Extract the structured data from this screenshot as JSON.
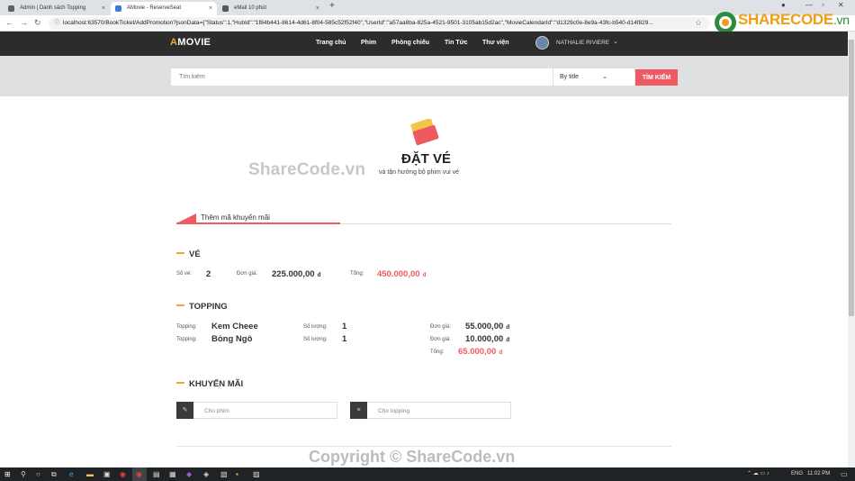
{
  "browser": {
    "tabs": [
      {
        "title": "Admin | Danh sách Topping",
        "close": "×",
        "fav_color": "#5f6368"
      },
      {
        "title": "AMovie - ReserveSeat",
        "close": "×",
        "fav_color": "#3d7ad6"
      },
      {
        "title": "eMail 10 phút",
        "close": "×",
        "fav_color": "#555555"
      }
    ],
    "new_tab": "+",
    "url": "localhost:63570/BookTicket/AddPromotion?jsonData={\"Status\":1,\"HubId\":\"1f84b441-8614-4d61-8f04-585c52f52f40\",\"UserId\":\"a57aa8ba-825a-4521-9501-3105ab15d2ac\",\"MovieCalendarId\":\"d1329c0e-8e9a-43fc-b540-d14f829..."
  },
  "header": {
    "logo_prefix": "A",
    "logo_rest": "MOVIE",
    "menu": [
      "Trang chủ",
      "Phim",
      "Phòng chiếu",
      "Tin Tức",
      "Thư viện"
    ],
    "user_name": "NATHALIE RIVIERE"
  },
  "search": {
    "placeholder": "Tìm kiếm",
    "select_value": "By title",
    "button": "TÌM KIẾM"
  },
  "page": {
    "title": "ĐẶT VÉ",
    "subtitle": "và tận hưởng bộ phim vui vẻ",
    "tab_label": "Thêm mã khuyến mãi"
  },
  "ticket": {
    "section": "VÉ",
    "qty_label": "Số vé:",
    "qty": "2",
    "price_label": "Đơn giá:",
    "price": "225.000,00",
    "total_label": "Tổng:",
    "total": "450.000,00",
    "currency": "đ"
  },
  "topping": {
    "section": "TOPPING",
    "item_label": "Topping:",
    "qty_label": "Số lượng:",
    "price_label": "Đơn giá:",
    "total_label": "Tổng:",
    "items": [
      {
        "name": "Kem Cheee",
        "qty": "1",
        "price": "55.000,00"
      },
      {
        "name": "Bỏng Ngô",
        "qty": "1",
        "price": "10.000,00"
      }
    ],
    "total": "65.000,00",
    "currency": "đ"
  },
  "promotion": {
    "section": "KHUYẾN MÃI",
    "movie_placeholder": "Cho phim",
    "topping_placeholder": "Cho topping"
  },
  "watermark": {
    "text": "ShareCode.vn",
    "copyright": "Copyright © ShareCode.vn",
    "brand_main": "SHARECODE",
    "brand_suffix": ".vn"
  },
  "taskbar": {
    "lang": "ENG",
    "time": "11:02 PM"
  },
  "colors": {
    "accent": "#ef5a62",
    "header_bg": "#2c2c2c",
    "logo_accent": "#f3a43b"
  }
}
